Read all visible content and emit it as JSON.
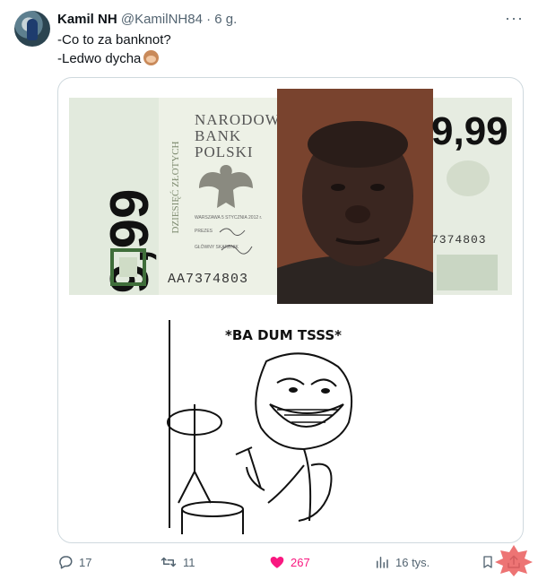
{
  "tweet": {
    "author_name": "Kamil NH",
    "handle": "@KamilNH84",
    "separator": "·",
    "time": "6 g.",
    "more_label": "···",
    "line1": "-Co to za banknot?",
    "line2": "-Ledwo dycha"
  },
  "banknote": {
    "amount_left": "9,99",
    "amount_right": "9,99",
    "bank_line1": "NARODOW",
    "bank_line2": "BANK",
    "bank_line3": "POLSKI",
    "vertical_text": "DZIESIĘĆ ZŁOTYCH",
    "serial_left": "AA7374803",
    "serial_right": "7374803",
    "place_date": "WARSZAWA 5 STYCZNIA 2012 r.",
    "signature_label1": "PREZES",
    "signature_label2": "GŁÓWNY SKARBNIK"
  },
  "meme": {
    "caption": "*BA DUM TSSS*"
  },
  "actions": {
    "replies": "17",
    "reposts": "11",
    "likes": "267",
    "views": "16 tys."
  },
  "colors": {
    "like": "#f91880",
    "secondary_text": "#536471",
    "border": "#cfd9de"
  }
}
